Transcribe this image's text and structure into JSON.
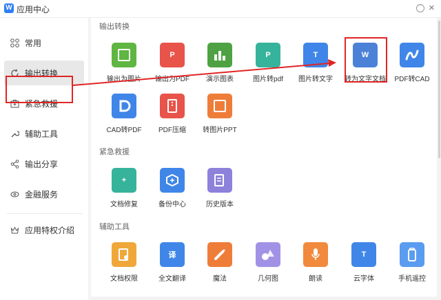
{
  "app": {
    "title": "应用中心",
    "logo": "W"
  },
  "sidebar": {
    "items": [
      {
        "label": "常用",
        "icon": "grid-icon"
      },
      {
        "label": "输出转换",
        "icon": "refresh-icon",
        "active": true
      },
      {
        "label": "紧急救援",
        "icon": "first-aid-icon"
      },
      {
        "label": "辅助工具",
        "icon": "wrench-icon"
      },
      {
        "label": "输出分享",
        "icon": "share-icon"
      },
      {
        "label": "金融服务",
        "icon": "finance-icon"
      },
      {
        "label": "应用特权介绍",
        "icon": "crown-icon"
      }
    ]
  },
  "sections": [
    {
      "title": "输出转换",
      "apps": [
        {
          "label": "输出为图片",
          "icon": "image-export-icon",
          "color": "#5fb642"
        },
        {
          "label": "输出为PDF",
          "icon": "pdf-export-icon",
          "color": "#e8534a"
        },
        {
          "label": "演示图表",
          "icon": "chart-icon",
          "color": "#4ea243"
        },
        {
          "label": "图片转pdf",
          "icon": "image-to-pdf-icon",
          "color": "#36b39b"
        },
        {
          "label": "图片转文字",
          "icon": "ocr-icon",
          "color": "#3f86e8"
        },
        {
          "label": "转为文字文档",
          "icon": "to-word-icon",
          "color": "#4b82d8"
        },
        {
          "label": "PDF转CAD",
          "icon": "pdf-to-cad-icon",
          "color": "#3f86e8"
        },
        {
          "label": "CAD转PDF",
          "icon": "cad-to-pdf-icon",
          "color": "#3f86e8"
        },
        {
          "label": "PDF压缩",
          "icon": "pdf-compress-icon",
          "color": "#e8534a"
        },
        {
          "label": "转图片PPT",
          "icon": "image-ppt-icon",
          "color": "#ef7d3a"
        }
      ]
    },
    {
      "title": "紧急救援",
      "apps": [
        {
          "label": "文档修复",
          "icon": "doc-repair-icon",
          "color": "#36b39b"
        },
        {
          "label": "备份中心",
          "icon": "backup-icon",
          "color": "#3f86e8"
        },
        {
          "label": "历史版本",
          "icon": "history-icon",
          "color": "#8c82db"
        }
      ]
    },
    {
      "title": "辅助工具",
      "apps": [
        {
          "label": "文档权限",
          "icon": "doc-permission-icon",
          "color": "#f0a73a"
        },
        {
          "label": "全文翻译",
          "icon": "translate-icon",
          "color": "#3f86e8"
        },
        {
          "label": "魔法",
          "icon": "magic-icon",
          "color": "#ef7d3a"
        },
        {
          "label": "几何图",
          "icon": "geometry-icon",
          "color": "#a292e6"
        },
        {
          "label": "朗读",
          "icon": "microphone-icon",
          "color": "#f18a3c"
        },
        {
          "label": "云字体",
          "icon": "cloud-font-icon",
          "color": "#3f86e8"
        },
        {
          "label": "手机遥控",
          "icon": "phone-remote-icon",
          "color": "#5a9cf0"
        }
      ]
    }
  ]
}
